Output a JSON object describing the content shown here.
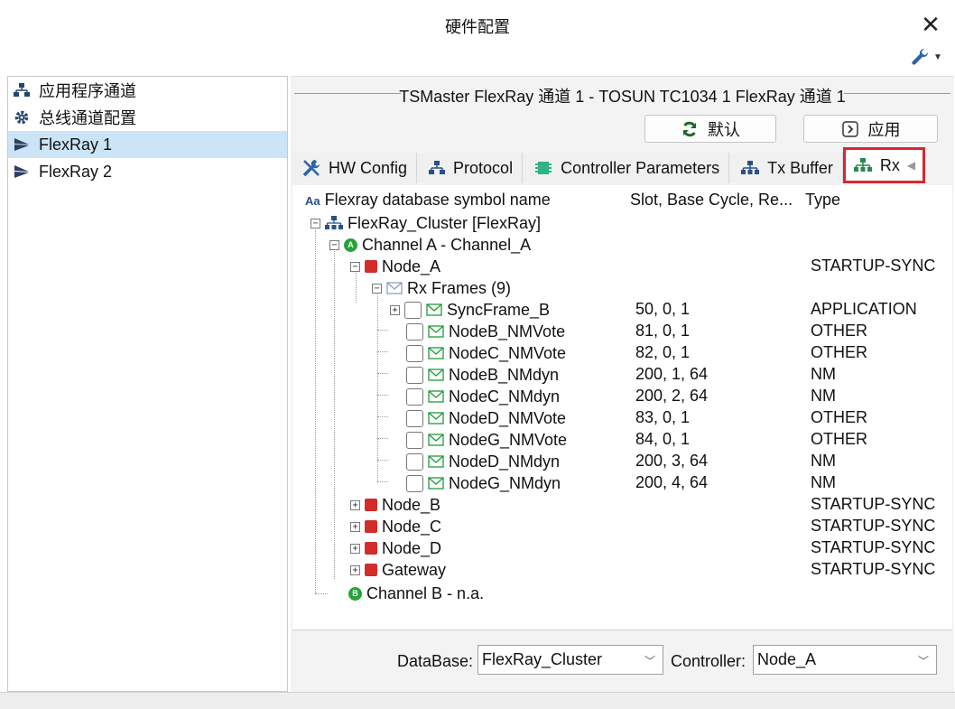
{
  "window": {
    "title": "硬件配置"
  },
  "sidebar": {
    "items": [
      {
        "label": "应用程序通道",
        "icon": "network-icon",
        "selected": false
      },
      {
        "label": "总线通道配置",
        "icon": "gear-icon",
        "selected": false
      },
      {
        "label": "FlexRay 1",
        "icon": "flexray-icon",
        "selected": true
      },
      {
        "label": "FlexRay 2",
        "icon": "flexray-icon",
        "selected": false
      }
    ]
  },
  "panel": {
    "group_title": "TSMaster FlexRay 通道 1 - TOSUN TC1034 1 FlexRay 通道 1",
    "default_label": "默认",
    "apply_label": "应用",
    "tabs": [
      {
        "label": "HW Config",
        "icon": "tools-icon"
      },
      {
        "label": "Protocol",
        "icon": "network-icon"
      },
      {
        "label": "Controller Parameters",
        "icon": "chip-icon"
      },
      {
        "label": "Tx Buffer",
        "icon": "network-icon"
      },
      {
        "label": "Rx",
        "icon": "network-icon",
        "active": true
      }
    ]
  },
  "tree": {
    "headers": {
      "name": "Flexray database symbol name",
      "name_prefix": "Aa",
      "slot": "Slot, Base Cycle, Re...",
      "type": "Type"
    },
    "cluster": "FlexRay_Cluster [FlexRay]",
    "channel_a": "Channel A - Channel_A",
    "channel_a_badge": "A",
    "node_a": {
      "name": "Node_A",
      "type": "STARTUP-SYNC"
    },
    "rx_frames": "Rx Frames (9)",
    "frames": [
      {
        "name": "SyncFrame_B",
        "slot": "50, 0, 1",
        "type": "APPLICATION"
      },
      {
        "name": "NodeB_NMVote",
        "slot": "81, 0, 1",
        "type": "OTHER"
      },
      {
        "name": "NodeC_NMVote",
        "slot": "82, 0, 1",
        "type": "OTHER"
      },
      {
        "name": "NodeB_NMdyn",
        "slot": "200, 1, 64",
        "type": "NM"
      },
      {
        "name": "NodeC_NMdyn",
        "slot": "200, 2, 64",
        "type": "NM"
      },
      {
        "name": "NodeD_NMVote",
        "slot": "83, 0, 1",
        "type": "OTHER"
      },
      {
        "name": "NodeG_NMVote",
        "slot": "84, 0, 1",
        "type": "OTHER"
      },
      {
        "name": "NodeD_NMdyn",
        "slot": "200, 3, 64",
        "type": "NM"
      },
      {
        "name": "NodeG_NMdyn",
        "slot": "200, 4, 64",
        "type": "NM"
      }
    ],
    "other_nodes": [
      {
        "name": "Node_B",
        "type": "STARTUP-SYNC"
      },
      {
        "name": "Node_C",
        "type": "STARTUP-SYNC"
      },
      {
        "name": "Node_D",
        "type": "STARTUP-SYNC"
      },
      {
        "name": "Gateway",
        "type": "STARTUP-SYNC"
      }
    ],
    "channel_b": "Channel B - n.a.",
    "channel_b_badge": "B"
  },
  "footer": {
    "database_label": "DataBase:",
    "database_value": "FlexRay_Cluster",
    "controller_label": "Controller:",
    "controller_value": "Node_A"
  },
  "colors": {
    "selected_bg": "#cce4f7",
    "highlight_border": "#d9272e",
    "node_red": "#d42b2b",
    "channel_green": "#27a33a",
    "frame_green": "#1f9a3a"
  }
}
